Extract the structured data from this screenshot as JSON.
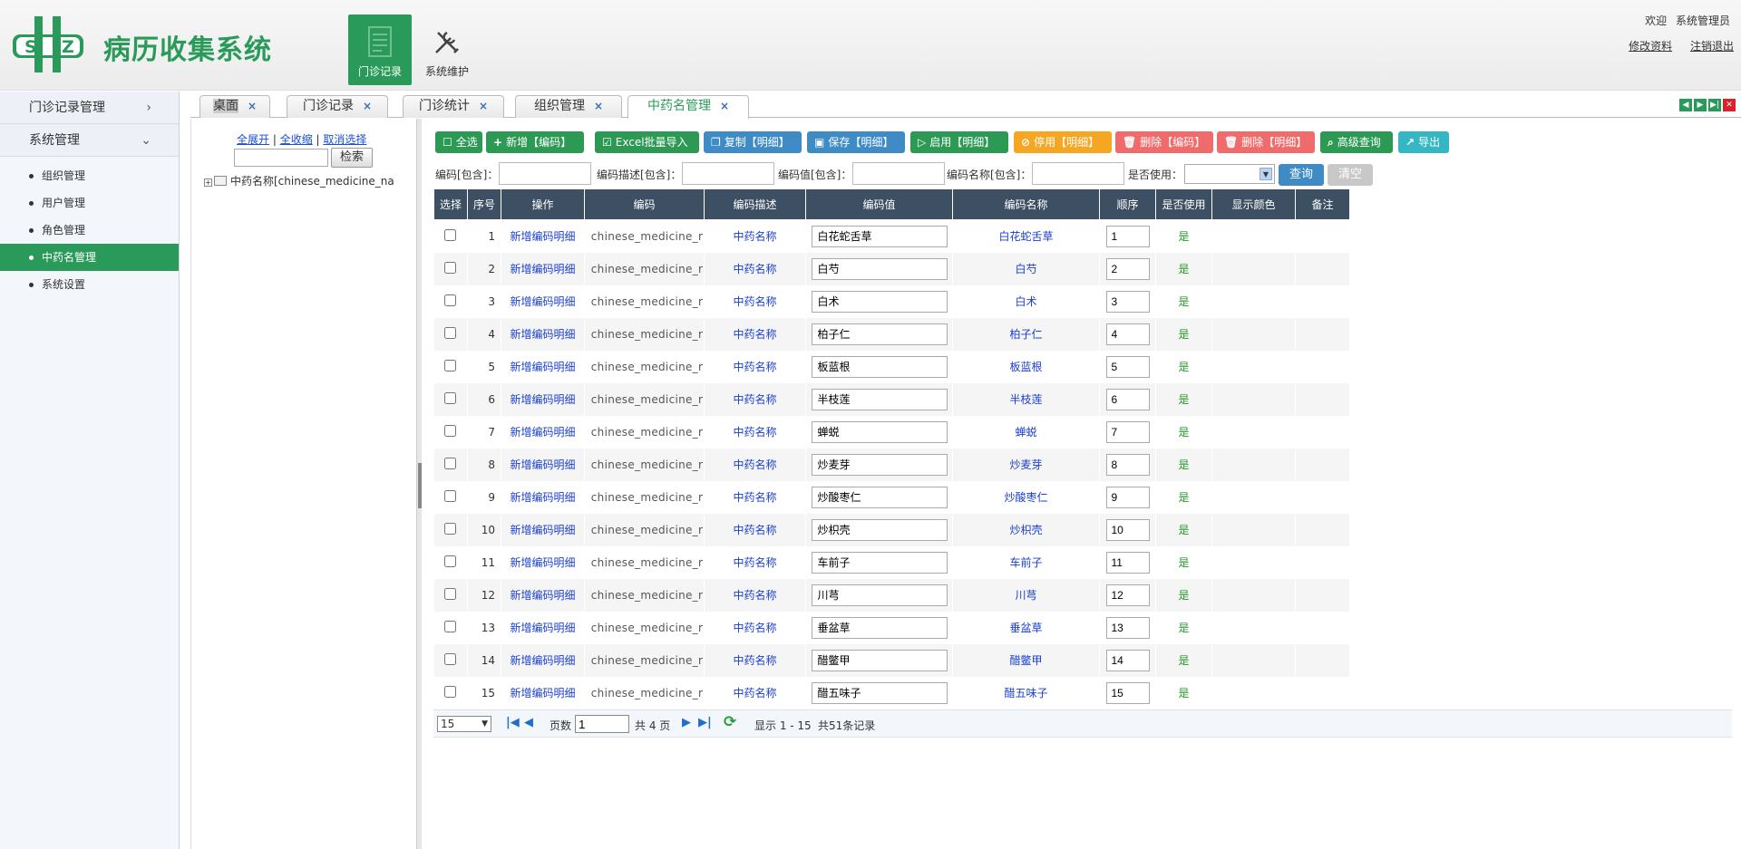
{
  "app": {
    "logo_text": "S Z",
    "title": "病历收集系统"
  },
  "nav": [
    {
      "label": "门诊记录",
      "active": true
    },
    {
      "label": "系统维护",
      "active": false
    }
  ],
  "user": {
    "welcome": "欢迎",
    "name": "系统管理员",
    "edit_profile": "修改资料",
    "logout": "注销退出"
  },
  "sidebar": {
    "groups": [
      {
        "label": "门诊记录管理",
        "arrow": "›"
      },
      {
        "label": "系统管理",
        "arrow": "⌄"
      }
    ],
    "items": [
      {
        "label": "组织管理"
      },
      {
        "label": "用户管理"
      },
      {
        "label": "角色管理"
      },
      {
        "label": "中药名管理"
      },
      {
        "label": "系统设置"
      }
    ]
  },
  "tabs": [
    {
      "label": "桌面"
    },
    {
      "label": "门诊记录"
    },
    {
      "label": "门诊统计"
    },
    {
      "label": "组织管理"
    },
    {
      "label": "中药名管理"
    }
  ],
  "tree": {
    "expand_all": "全展开",
    "collapse_all": "全收缩",
    "cancel_select": "取消选择",
    "search_button": "检索",
    "search_value": "",
    "node": "中药名称[chinese_medicine_na"
  },
  "toolbar": {
    "select_all": "全选",
    "add_code": "新增【编码】",
    "excel_import": "Excel批量导入",
    "copy_detail": "复制【明细】",
    "save_detail": "保存【明细】",
    "enable_detail": "启用【明细】",
    "disable_detail": "停用【明细】",
    "delete_code": "删除【编码】",
    "delete_detail": "删除【明细】",
    "advanced_query": "高级查询",
    "export": "导出"
  },
  "filter": {
    "code_label": "编码[包含]：",
    "desc_label": "编码描述[包含]：",
    "value_label": "编码值[包含]：",
    "name_label": "编码名称[包含]：",
    "use_label": "是否使用：",
    "query_button": "查询",
    "clear_button": "清空"
  },
  "grid": {
    "headers": [
      "选择",
      "序号",
      "操作",
      "编码",
      "编码描述",
      "编码值",
      "编码名称",
      "顺序",
      "是否使用",
      "显示颜色",
      "备注"
    ],
    "action_label": "新增编码明细",
    "code": "chinese_medicine_r",
    "desc": "中药名称",
    "used": "是",
    "rows": [
      {
        "no": "1",
        "value": "白花蛇舌草",
        "order": "1"
      },
      {
        "no": "2",
        "value": "白芍",
        "order": "2"
      },
      {
        "no": "3",
        "value": "白术",
        "order": "3"
      },
      {
        "no": "4",
        "value": "柏子仁",
        "order": "4"
      },
      {
        "no": "5",
        "value": "板蓝根",
        "order": "5"
      },
      {
        "no": "6",
        "value": "半枝莲",
        "order": "6"
      },
      {
        "no": "7",
        "value": "蝉蜕",
        "order": "7"
      },
      {
        "no": "8",
        "value": "炒麦芽",
        "order": "8"
      },
      {
        "no": "9",
        "value": "炒酸枣仁",
        "order": "9"
      },
      {
        "no": "10",
        "value": "炒枳壳",
        "order": "10"
      },
      {
        "no": "11",
        "value": "车前子",
        "order": "11"
      },
      {
        "no": "12",
        "value": "川芎",
        "order": "12"
      },
      {
        "no": "13",
        "value": "垂盆草",
        "order": "13"
      },
      {
        "no": "14",
        "value": "醋鳖甲",
        "order": "14"
      },
      {
        "no": "15",
        "value": "醋五味子",
        "order": "15"
      }
    ]
  },
  "pager": {
    "page_size": "15",
    "page_label": "页数",
    "page_value": "1",
    "total_pages": "共 4 页",
    "display": "显示 1 - 15",
    "total": "共51条记录"
  },
  "colors": {
    "brand": "#2a9a5a",
    "header_bg": "#3d4f62"
  }
}
